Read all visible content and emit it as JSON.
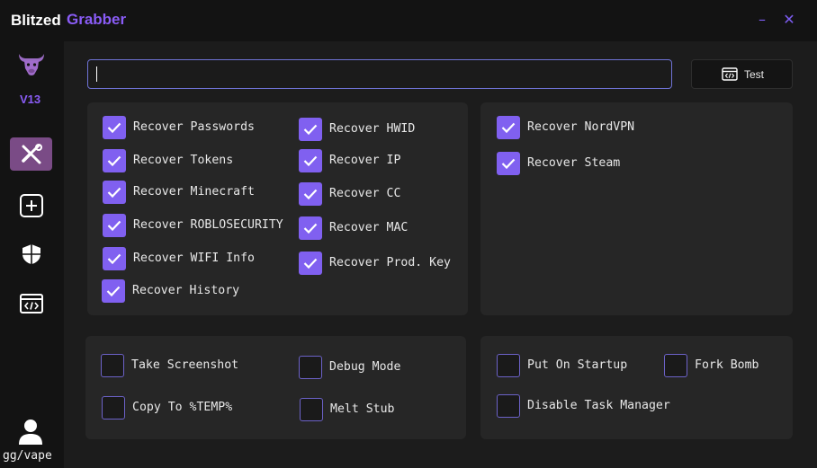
{
  "app": {
    "title_part1": "Blitzed",
    "title_part2": "Grabber",
    "version": "V13"
  },
  "window_controls": {
    "minimize": "–",
    "close": "✕"
  },
  "sidebar": {
    "logo_icon": "bull-head-icon",
    "items": [
      {
        "icon": "tools-icon",
        "active": true
      },
      {
        "icon": "plus-square-icon",
        "active": false
      },
      {
        "icon": "shield-icon",
        "active": false
      },
      {
        "icon": "code-window-icon",
        "active": false
      }
    ],
    "user": {
      "icon": "user-icon",
      "label": "gg/vape"
    }
  },
  "webhook": {
    "value": "",
    "placeholder": ""
  },
  "test_button": {
    "icon": "code-window-icon",
    "label": "Test"
  },
  "recover_options": {
    "col1": [
      {
        "label": "Recover Passwords",
        "checked": true
      },
      {
        "label": "Recover Tokens",
        "checked": true
      },
      {
        "label": "Recover Minecraft",
        "checked": true
      },
      {
        "label": "Recover ROBLOSECURITY",
        "checked": true
      },
      {
        "label": "Recover WIFI Info",
        "checked": true
      },
      {
        "label": "Recover History",
        "checked": true
      }
    ],
    "col2": [
      {
        "label": "Recover HWID",
        "checked": true
      },
      {
        "label": "Recover IP",
        "checked": true
      },
      {
        "label": "Recover CC",
        "checked": true
      },
      {
        "label": "Recover MAC",
        "checked": true
      },
      {
        "label": "Recover Prod. Key",
        "checked": true
      }
    ],
    "col3": [
      {
        "label": "Recover NordVPN",
        "checked": true
      },
      {
        "label": "Recover Steam",
        "checked": true
      }
    ]
  },
  "misc_options": {
    "left": [
      {
        "label": "Take Screenshot",
        "checked": false
      },
      {
        "label": "Copy To %TEMP%",
        "checked": false
      },
      {
        "label": "Debug Mode",
        "checked": false
      },
      {
        "label": "Melt Stub",
        "checked": false
      }
    ],
    "right": [
      {
        "label": "Put On Startup",
        "checked": false
      },
      {
        "label": "Fork Bomb",
        "checked": false
      },
      {
        "label": "Disable Task Manager",
        "checked": false
      }
    ]
  },
  "colors": {
    "accent": "#8060f0",
    "title_accent": "#8a5cf6",
    "active_nav": "#7a4b86",
    "input_border": "#6f73d6"
  }
}
